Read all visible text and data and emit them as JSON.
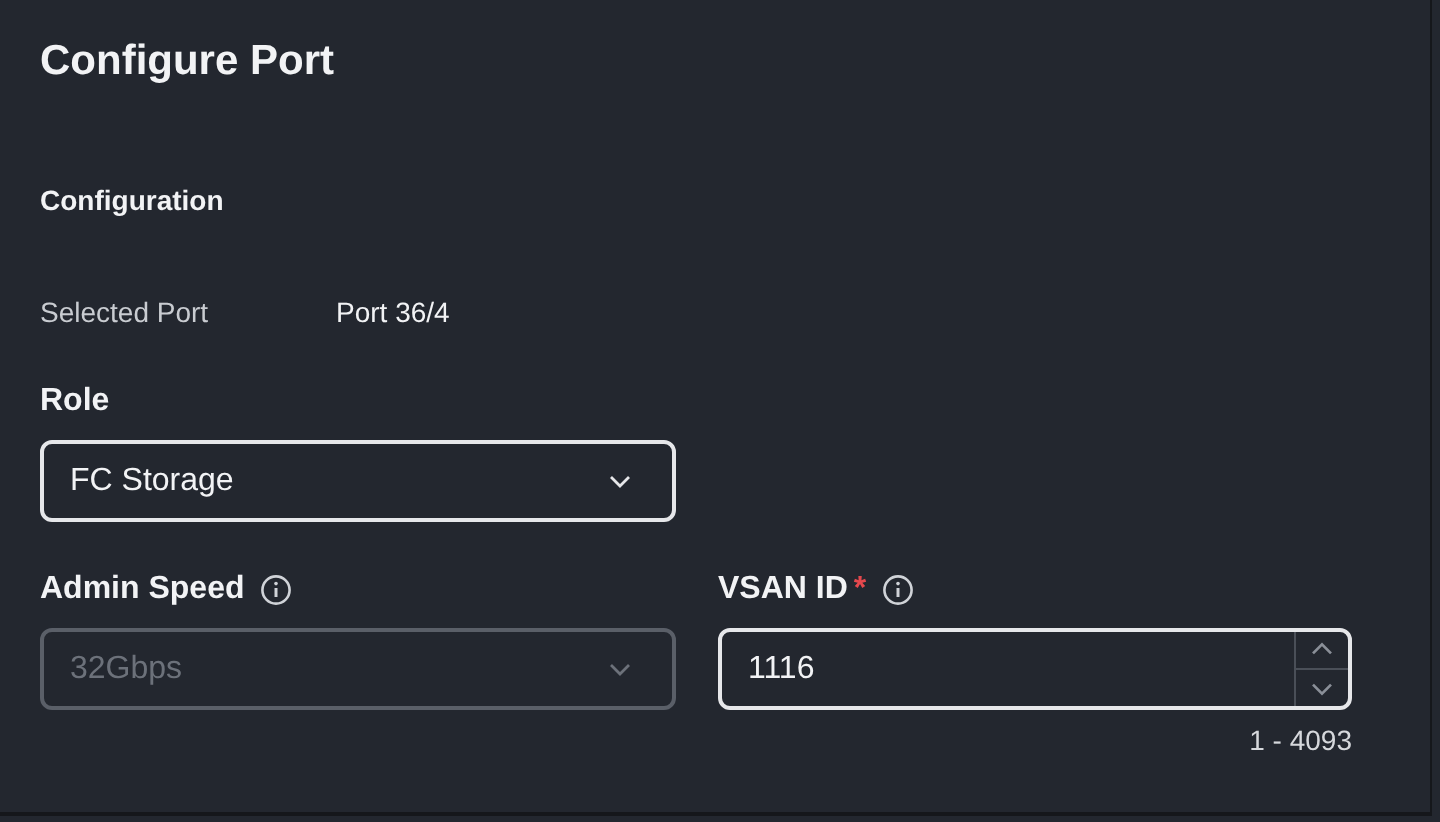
{
  "title": "Configure Port",
  "section": "Configuration",
  "selected_port": {
    "label": "Selected Port",
    "value": "Port 36/4"
  },
  "fields": [
    {
      "kind": "select",
      "label": "Role",
      "value": "FC Storage",
      "disabled": false,
      "info": false
    },
    {
      "kind": "select",
      "label": "Admin Speed",
      "value": "32Gbps",
      "disabled": true,
      "info": true
    },
    {
      "kind": "number",
      "label": "VSAN ID",
      "value": "1116",
      "disabled": false,
      "info": true,
      "required_mark": "*",
      "hint": "1 - 4093"
    }
  ]
}
